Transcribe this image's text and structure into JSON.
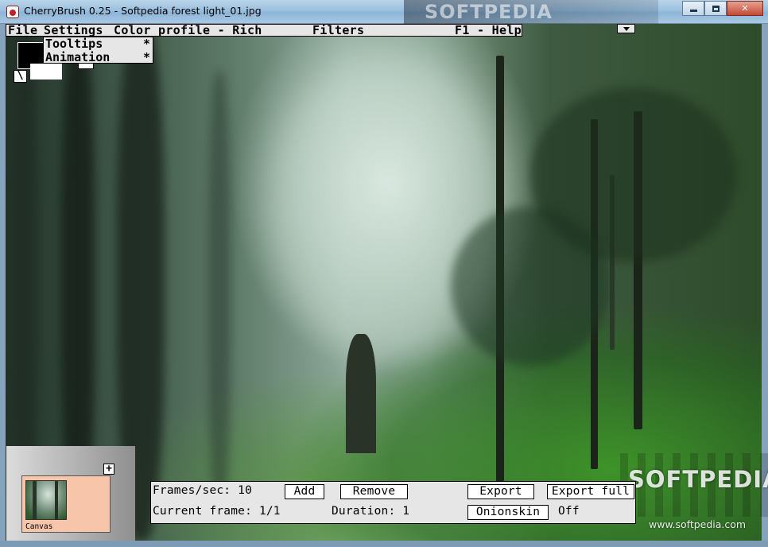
{
  "window": {
    "title": "CherryBrush 0.25 - Softpedia forest light_01.jpg",
    "watermark": "SOFTPEDIA",
    "min_label": "",
    "max_label": "",
    "close_label": "✕"
  },
  "menu": {
    "file": "File",
    "settings": "Settings",
    "color_profile": "Color profile - Rich",
    "filters": "Filters",
    "help": "F1 - Help"
  },
  "settings_menu": {
    "items": [
      {
        "label": "Tooltips",
        "mark": "*"
      },
      {
        "label": "Animation",
        "mark": "*"
      }
    ]
  },
  "tools": {
    "tool_glyph": "\\",
    "foreground_color": "#000000",
    "background_color": "#ffffff"
  },
  "layers": {
    "add_glyph": "+",
    "canvas_label": "Canvas",
    "card_color": "#f7c6aa"
  },
  "animation": {
    "fps_label": "Frames/sec: 10",
    "add": "Add",
    "remove": "Remove",
    "export": "Export",
    "export_full": "Export full",
    "current_frame": "Current frame: 1/1",
    "duration": "Duration: 1",
    "onionskin": "Onionskin",
    "onionskin_state": "Off"
  },
  "watermark": {
    "logo": "SOFTPEDIA",
    "url": "www.softpedia.com"
  }
}
